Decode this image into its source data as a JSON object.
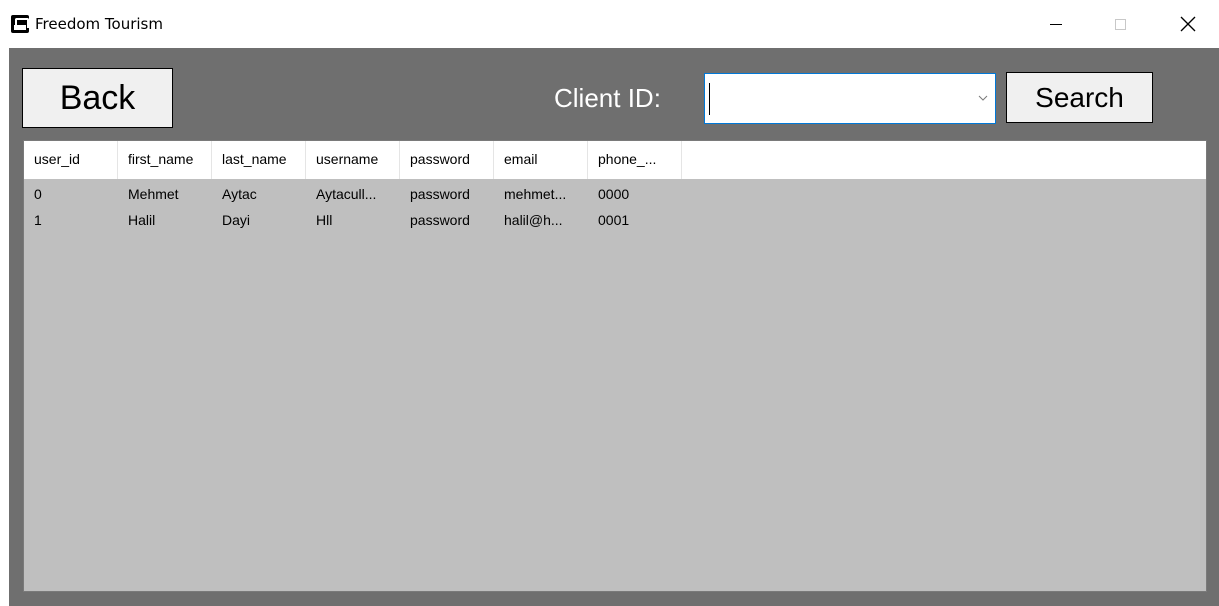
{
  "window": {
    "title": "Freedom Tourism",
    "controls": {
      "minimize": "minimize",
      "maximize": "maximize",
      "close": "close"
    }
  },
  "toolbar": {
    "back_label": "Back",
    "client_id_label": "Client ID:",
    "client_id_value": "",
    "search_label": "Search"
  },
  "table": {
    "columns": [
      "user_id",
      "first_name",
      "last_name",
      "username",
      "password",
      "email",
      "phone_..."
    ],
    "rows": [
      [
        "0",
        "Mehmet",
        "Aytac",
        "Aytacull...",
        "password",
        "mehmet...",
        "0000"
      ],
      [
        "1",
        "Halil",
        "Dayi",
        "Hll",
        "password",
        "halil@h...",
        "0001"
      ]
    ]
  },
  "colors": {
    "client_bg": "#6f6f6f",
    "grid_bg": "#bfbfbf",
    "focus_border": "#0078d7"
  }
}
